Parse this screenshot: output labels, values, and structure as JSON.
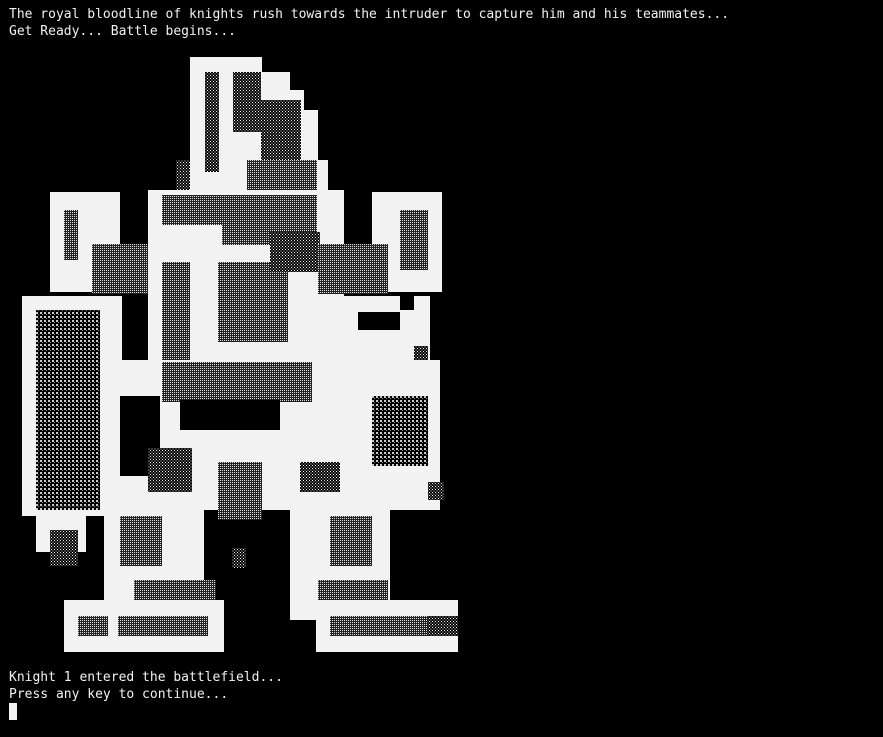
{
  "console": {
    "lines": [
      "The royal bloodline of knights rush towards the intruder to capture him and his teammates...",
      "Get Ready... Battle begins...",
      "Knight 1 entered the battlefield...",
      "Press any key to continue..."
    ]
  },
  "sprite": {
    "icon": "knight-ascii-art-icon",
    "colors": {
      "background": "#000000",
      "foreground": "#f2f2f2"
    }
  }
}
